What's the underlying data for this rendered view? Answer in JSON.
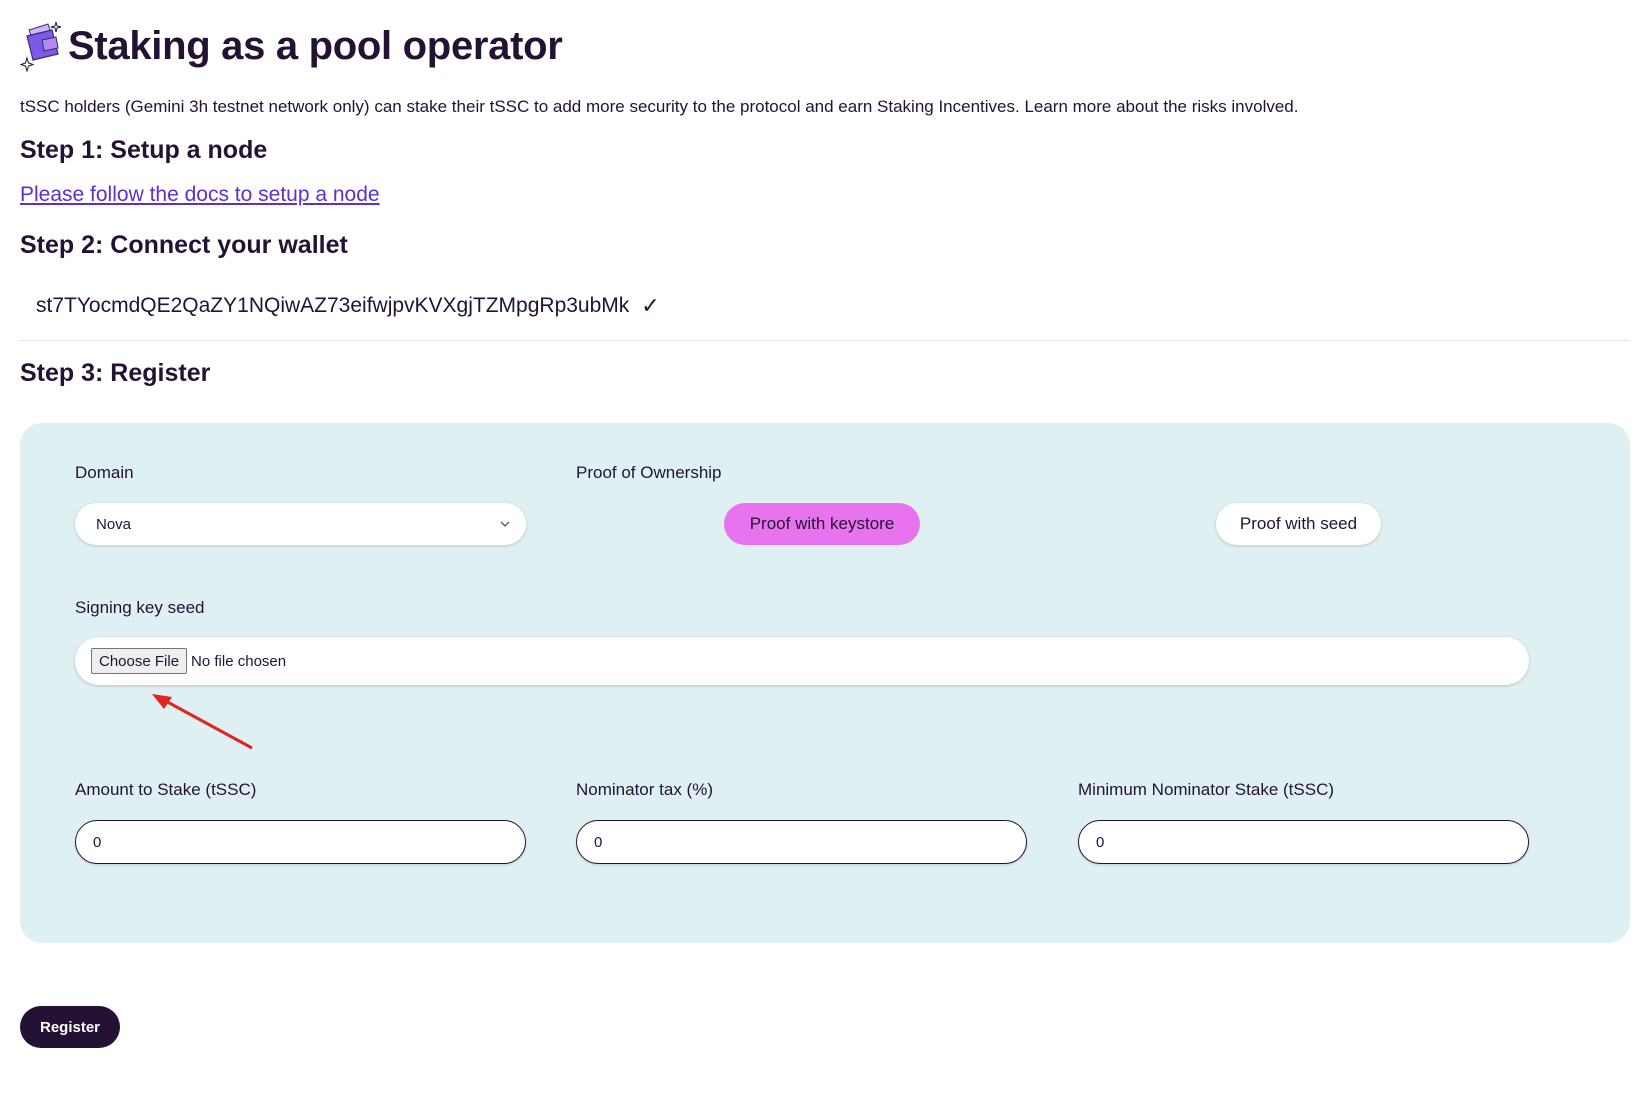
{
  "header": {
    "logo_icon": "wallet-sparkle-icon",
    "title": "Staking as a pool operator"
  },
  "intro": "tSSC holders (Gemini 3h testnet network only) can stake their tSSC to add more security to the protocol and earn Staking Incentives. Learn more about the risks involved.",
  "step1": {
    "heading": "Step 1: Setup a node",
    "link_text": "Please follow the docs to setup a node"
  },
  "step2": {
    "heading": "Step 2: Connect your wallet",
    "wallet_address": "st7TYocmdQE2QaZY1NQiwAZ73eifwjpvKVXgjTZMpgRp3ubMk",
    "connected_mark": "✓"
  },
  "step3": {
    "heading": "Step 3: Register",
    "domain": {
      "label": "Domain",
      "selected": "Nova"
    },
    "proof": {
      "label": "Proof of Ownership",
      "option_keystore": "Proof with keystore",
      "option_seed": "Proof with seed",
      "active": "keystore"
    },
    "signing_key": {
      "label": "Signing key seed",
      "button_label": "Choose File",
      "status": "No file chosen"
    },
    "amount": {
      "label": "Amount to Stake (tSSC)",
      "value": "0"
    },
    "nominator_tax": {
      "label": "Nominator tax (%)",
      "value": "0"
    },
    "min_nominator_stake": {
      "label": "Minimum Nominator Stake (tSSC)",
      "value": "0"
    }
  },
  "register_button": "Register",
  "colors": {
    "primary": "#241235",
    "accent_pink": "#e873ef",
    "panel_bg": "#dff0f2",
    "link": "#5b2fd1",
    "annotation_arrow": "#e02424"
  }
}
